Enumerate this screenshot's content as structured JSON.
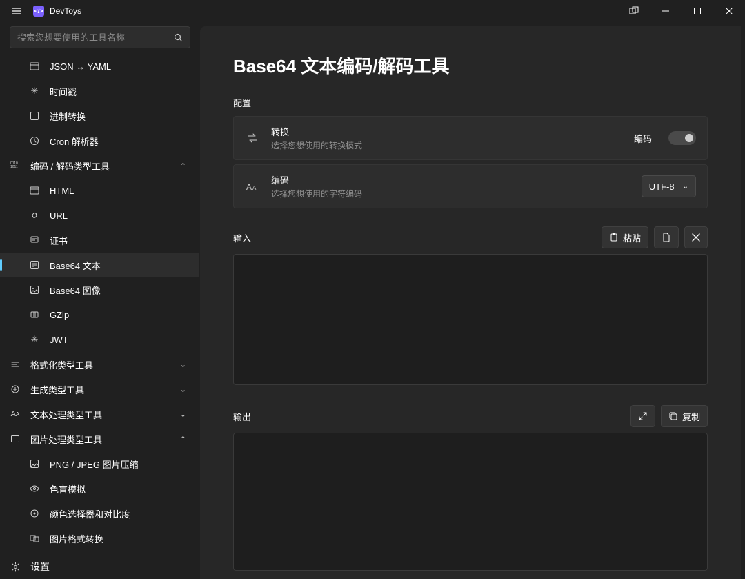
{
  "app": {
    "title": "DevToys"
  },
  "search": {
    "placeholder": "搜索您想要使用的工具名称"
  },
  "sidebar": {
    "top_items": [
      {
        "label": "JSON ↔ YAML",
        "iconKey": "jsonyaml"
      },
      {
        "label": "时间戳",
        "iconKey": "time"
      },
      {
        "label": "进制转换",
        "iconKey": "base"
      },
      {
        "label": "Cron 解析器",
        "iconKey": "cron"
      }
    ],
    "category_encode": {
      "label": "编码 / 解码类型工具"
    },
    "encode_items": [
      {
        "label": "HTML",
        "iconKey": "html"
      },
      {
        "label": "URL",
        "iconKey": "url"
      },
      {
        "label": "证书",
        "iconKey": "cert"
      },
      {
        "label": "Base64 文本",
        "iconKey": "b64t",
        "selected": true
      },
      {
        "label": "Base64 图像",
        "iconKey": "b64i"
      },
      {
        "label": "GZip",
        "iconKey": "gzip"
      },
      {
        "label": "JWT",
        "iconKey": "jwt"
      }
    ],
    "category_format": {
      "label": "格式化类型工具"
    },
    "category_gen": {
      "label": "生成类型工具"
    },
    "category_text": {
      "label": "文本处理类型工具"
    },
    "category_image": {
      "label": "图片处理类型工具"
    },
    "image_items": [
      {
        "label": "PNG / JPEG 图片压缩",
        "iconKey": "compress"
      },
      {
        "label": "色盲模拟",
        "iconKey": "blind"
      },
      {
        "label": "颜色选择器和对比度",
        "iconKey": "picker"
      },
      {
        "label": "图片格式转换",
        "iconKey": "convert"
      }
    ],
    "settings_label": "设置"
  },
  "page": {
    "title": "Base64 文本编码/解码工具",
    "config_label": "配置",
    "convert": {
      "title": "转换",
      "desc": "选择您想使用的转换模式",
      "toggle_label": "编码"
    },
    "encoding": {
      "title": "编码",
      "desc": "选择您想使用的字符编码",
      "dropdown_value": "UTF-8"
    },
    "input": {
      "label": "输入",
      "paste": "粘贴"
    },
    "output": {
      "label": "输出",
      "copy": "复制"
    }
  }
}
